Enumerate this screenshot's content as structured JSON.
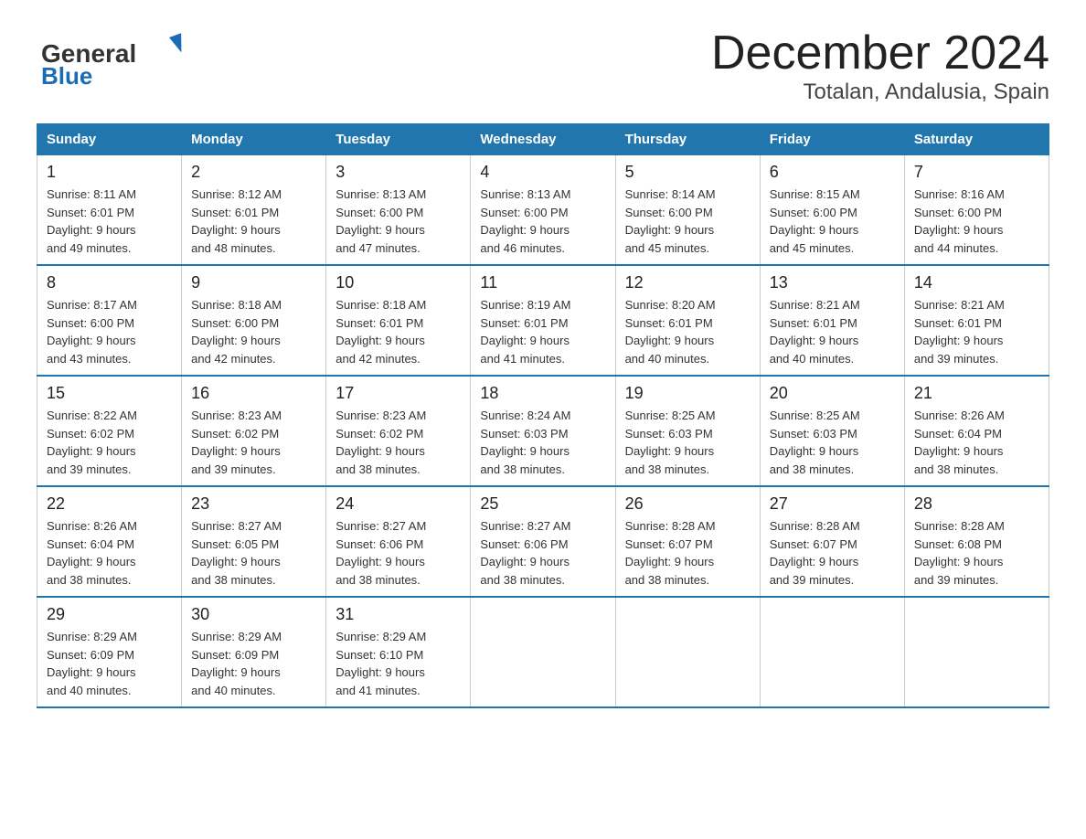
{
  "header": {
    "logo_general": "General",
    "logo_blue": "Blue",
    "month_title": "December 2024",
    "location": "Totalan, Andalusia, Spain"
  },
  "days_of_week": [
    "Sunday",
    "Monday",
    "Tuesday",
    "Wednesday",
    "Thursday",
    "Friday",
    "Saturday"
  ],
  "weeks": [
    [
      {
        "day": "1",
        "sunrise": "8:11 AM",
        "sunset": "6:01 PM",
        "daylight_hours": "9 hours",
        "daylight_minutes": "and 49 minutes."
      },
      {
        "day": "2",
        "sunrise": "8:12 AM",
        "sunset": "6:01 PM",
        "daylight_hours": "9 hours",
        "daylight_minutes": "and 48 minutes."
      },
      {
        "day": "3",
        "sunrise": "8:13 AM",
        "sunset": "6:00 PM",
        "daylight_hours": "9 hours",
        "daylight_minutes": "and 47 minutes."
      },
      {
        "day": "4",
        "sunrise": "8:13 AM",
        "sunset": "6:00 PM",
        "daylight_hours": "9 hours",
        "daylight_minutes": "and 46 minutes."
      },
      {
        "day": "5",
        "sunrise": "8:14 AM",
        "sunset": "6:00 PM",
        "daylight_hours": "9 hours",
        "daylight_minutes": "and 45 minutes."
      },
      {
        "day": "6",
        "sunrise": "8:15 AM",
        "sunset": "6:00 PM",
        "daylight_hours": "9 hours",
        "daylight_minutes": "and 45 minutes."
      },
      {
        "day": "7",
        "sunrise": "8:16 AM",
        "sunset": "6:00 PM",
        "daylight_hours": "9 hours",
        "daylight_minutes": "and 44 minutes."
      }
    ],
    [
      {
        "day": "8",
        "sunrise": "8:17 AM",
        "sunset": "6:00 PM",
        "daylight_hours": "9 hours",
        "daylight_minutes": "and 43 minutes."
      },
      {
        "day": "9",
        "sunrise": "8:18 AM",
        "sunset": "6:00 PM",
        "daylight_hours": "9 hours",
        "daylight_minutes": "and 42 minutes."
      },
      {
        "day": "10",
        "sunrise": "8:18 AM",
        "sunset": "6:01 PM",
        "daylight_hours": "9 hours",
        "daylight_minutes": "and 42 minutes."
      },
      {
        "day": "11",
        "sunrise": "8:19 AM",
        "sunset": "6:01 PM",
        "daylight_hours": "9 hours",
        "daylight_minutes": "and 41 minutes."
      },
      {
        "day": "12",
        "sunrise": "8:20 AM",
        "sunset": "6:01 PM",
        "daylight_hours": "9 hours",
        "daylight_minutes": "and 40 minutes."
      },
      {
        "day": "13",
        "sunrise": "8:21 AM",
        "sunset": "6:01 PM",
        "daylight_hours": "9 hours",
        "daylight_minutes": "and 40 minutes."
      },
      {
        "day": "14",
        "sunrise": "8:21 AM",
        "sunset": "6:01 PM",
        "daylight_hours": "9 hours",
        "daylight_minutes": "and 39 minutes."
      }
    ],
    [
      {
        "day": "15",
        "sunrise": "8:22 AM",
        "sunset": "6:02 PM",
        "daylight_hours": "9 hours",
        "daylight_minutes": "and 39 minutes."
      },
      {
        "day": "16",
        "sunrise": "8:23 AM",
        "sunset": "6:02 PM",
        "daylight_hours": "9 hours",
        "daylight_minutes": "and 39 minutes."
      },
      {
        "day": "17",
        "sunrise": "8:23 AM",
        "sunset": "6:02 PM",
        "daylight_hours": "9 hours",
        "daylight_minutes": "and 38 minutes."
      },
      {
        "day": "18",
        "sunrise": "8:24 AM",
        "sunset": "6:03 PM",
        "daylight_hours": "9 hours",
        "daylight_minutes": "and 38 minutes."
      },
      {
        "day": "19",
        "sunrise": "8:25 AM",
        "sunset": "6:03 PM",
        "daylight_hours": "9 hours",
        "daylight_minutes": "and 38 minutes."
      },
      {
        "day": "20",
        "sunrise": "8:25 AM",
        "sunset": "6:03 PM",
        "daylight_hours": "9 hours",
        "daylight_minutes": "and 38 minutes."
      },
      {
        "day": "21",
        "sunrise": "8:26 AM",
        "sunset": "6:04 PM",
        "daylight_hours": "9 hours",
        "daylight_minutes": "and 38 minutes."
      }
    ],
    [
      {
        "day": "22",
        "sunrise": "8:26 AM",
        "sunset": "6:04 PM",
        "daylight_hours": "9 hours",
        "daylight_minutes": "and 38 minutes."
      },
      {
        "day": "23",
        "sunrise": "8:27 AM",
        "sunset": "6:05 PM",
        "daylight_hours": "9 hours",
        "daylight_minutes": "and 38 minutes."
      },
      {
        "day": "24",
        "sunrise": "8:27 AM",
        "sunset": "6:06 PM",
        "daylight_hours": "9 hours",
        "daylight_minutes": "and 38 minutes."
      },
      {
        "day": "25",
        "sunrise": "8:27 AM",
        "sunset": "6:06 PM",
        "daylight_hours": "9 hours",
        "daylight_minutes": "and 38 minutes."
      },
      {
        "day": "26",
        "sunrise": "8:28 AM",
        "sunset": "6:07 PM",
        "daylight_hours": "9 hours",
        "daylight_minutes": "and 38 minutes."
      },
      {
        "day": "27",
        "sunrise": "8:28 AM",
        "sunset": "6:07 PM",
        "daylight_hours": "9 hours",
        "daylight_minutes": "and 39 minutes."
      },
      {
        "day": "28",
        "sunrise": "8:28 AM",
        "sunset": "6:08 PM",
        "daylight_hours": "9 hours",
        "daylight_minutes": "and 39 minutes."
      }
    ],
    [
      {
        "day": "29",
        "sunrise": "8:29 AM",
        "sunset": "6:09 PM",
        "daylight_hours": "9 hours",
        "daylight_minutes": "and 40 minutes."
      },
      {
        "day": "30",
        "sunrise": "8:29 AM",
        "sunset": "6:09 PM",
        "daylight_hours": "9 hours",
        "daylight_minutes": "and 40 minutes."
      },
      {
        "day": "31",
        "sunrise": "8:29 AM",
        "sunset": "6:10 PM",
        "daylight_hours": "9 hours",
        "daylight_minutes": "and 41 minutes."
      },
      null,
      null,
      null,
      null
    ]
  ],
  "labels": {
    "sunrise": "Sunrise:",
    "sunset": "Sunset:",
    "daylight": "Daylight:"
  }
}
